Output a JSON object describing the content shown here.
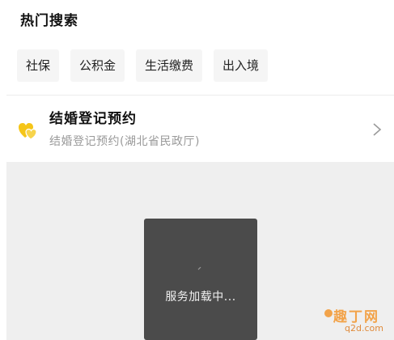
{
  "hot_search": {
    "title": "热门搜索",
    "tags": [
      {
        "label": "社保"
      },
      {
        "label": "公积金"
      },
      {
        "label": "生活缴费"
      },
      {
        "label": "出入境"
      }
    ]
  },
  "service": {
    "icon": "heart-couple-icon",
    "icon_color": "#f5c518",
    "title": "结婚登记预约",
    "subtitle": "结婚登记预约(湖北省民政厅)",
    "chevron": "chevron-right-icon"
  },
  "loading": {
    "text": "服务加载中...",
    "icon": "spinner-icon"
  },
  "watermark": {
    "main": "趣丁网",
    "sub": "q2d.com"
  },
  "colors": {
    "chip_bg": "#f5f5f5",
    "loading_bg": "#4b4b4b",
    "area_bg": "#efefef",
    "watermark": "#f2a34a"
  }
}
